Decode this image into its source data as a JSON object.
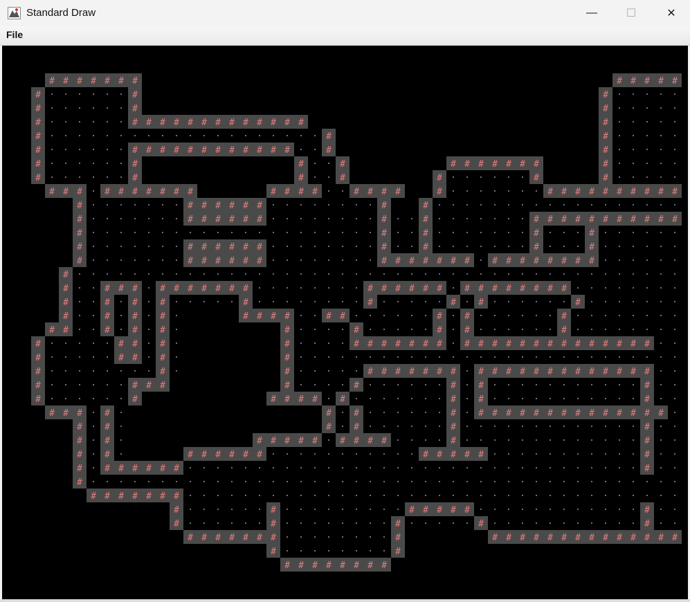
{
  "window": {
    "title": "Standard Draw",
    "minimize_glyph": "—",
    "maximize_glyph": "☐",
    "close_glyph": "✕"
  },
  "menu": {
    "file_label": "File"
  },
  "colors": {
    "canvas_bg": "#000000",
    "wall_fill": "#4a4a4a",
    "wall_glyph": "#e07c7c",
    "floor_dot": "#c8c8c8"
  },
  "glyphs": {
    "wall": "#",
    "floor": "·"
  },
  "tile_map": [
    "..........................................................",
    "..........................................................",
    "...WWWWWWW..................................WWWWWWW.......",
    "..WFFFFFFW.................................WFFFFFFW.......",
    "..WFFFFFFW.................................WFFFFFFW.......",
    "..WFFFFFFWWWWWWWWWWWWW.....................WFFFFFFW.......",
    "..WFFFFFFFFFFFFFFFFFFFFW...................WFFFFFFW.......",
    "..WFFFFFFWWWWWWWWWWWWFFW...................WFFFFFFW.......",
    "..WFFFFFFW...........WFFW.......WWWWWWW....WFFFFFFW.......",
    "..WFFFFFFW...........WFFW......WFFFFFFW....WFFFFFFW.......",
    "...WWWFWWWWWWW.....WWWWFFWWWW..WFFFFFFFWWWWWWWWWWFWWWW....",
    ".....WFFFFFFFWWWWWWFFFFFFFFW..WFFFFFFFFFFFFFFFFFFFFFFW.....",
    ".....WFFFFFFFWWWWWWFFFFFFFFWFFWFFFFFFFWWWWWWWWWWWFFFWWW....",
    ".....WFFFFFFFFFFFFFFFFFFFFFWFFWFFFFFFFWFFFWFFFFFFFFFFW.....",
    ".....WFFFFFFFWWWWWWFFFFFFFFWFFWFFFFFFFWFFFWFFFFFFFFFFW.....",
    ".....WFFFFFFFWWWWWWFFFFFFFFWWWWWWWFWWWWWWWWFFFFFFFFFFFW....",
    "....WFFFFFFFFFFFFFFFFFFFFFFFFFFFFFFFFFFFFFFFFFFFFFFFFW....",
    "....WFFWWWFWWWWWWWFFFFFFFFWWWWWWFWWWWWWWWFFFFFFFFFFFFW....",
    "....WFFWFWFWFFFFFWFFFFFFFFWFFFFFWFWFFFFFFWFFFFFFFFFFFW....",
    "....WFFWFWFWF....WWWWFFWWFFFFFFWFWFFFFFFWFFFFFFFFFFFFW....",
    "...WWFFWFWFWF.......WFFFFWFFFFFWFWFFFFFFWFFFFFFFFFFFFW....",
    "..WFFFFFWWFWF.......WFFFFWWWWWWWFWWWWWWWWWWWWWWFFFWWW.....",
    "..WFFFFFWWFWF.......WFFFFFFFFFFFFFFFFFFFFFFFFFFFFFW.......",
    "..WFFFFFFFFWF.......WFFFFFWWWWWWWFWWWWWWWWWWWWWFFFW.......",
    "..WFFFFFFWWW........WFFFFWFFFFFFWFWFFFFFFFFFFFWFFFW.......",
    "..WFFFFFFW.........WWWWFWFFFFFFFWFWFFFFFFFFFFFWFFFW.......",
    "...WWWFWF..............WFWFFFFFFWFWWWWWWWWWWWWWWFFWWW.....",
    ".....WFWF..............WFWFFFFFFWFFFFFFFFFFFFFWFFFFFFFW...",
    ".....WFWF.........WWWWWFWWWWFFFFWFFFFFFFFFFFFFWFFFFFFFFW..",
    ".....WFWF....WWWWWWFFFFFFFFFFFWWWWWFFFFFFFFFFFWFFFFFFFFW..",
    ".....WFWWWWWWFFFFFFFFFFFFFFFFFFFFFFFFFFFFFFFFFWFFFFFFFFW..",
    ".....WFFFFFFFFFFFFFFFFFFFFFFFFFFFFFFFFFFFFFFFFFFFFFFFFFW..",
    "......WWWWWWWFFFFFFFFFFFFFFFFFFFFFFFFFFFFFFFFFFFFFFFFFFW..",
    "............WFFFFFFWFFFFFFFFFWWWWWFFFFFFFFFFFFWFFFFFFFFW..",
    "............WFFFFFFWFFFFFFFFWFFFFFWFFFFFFFFFFFWFFFFFFFFW..",
    ".............WWWWWWWFFFFFFFFW......WWWWWWWWWWWWWWWWWWWWW...",
    "...................WFFFFFFFFW.............................",
    "....................WWWWWWWW.............................."
  ]
}
